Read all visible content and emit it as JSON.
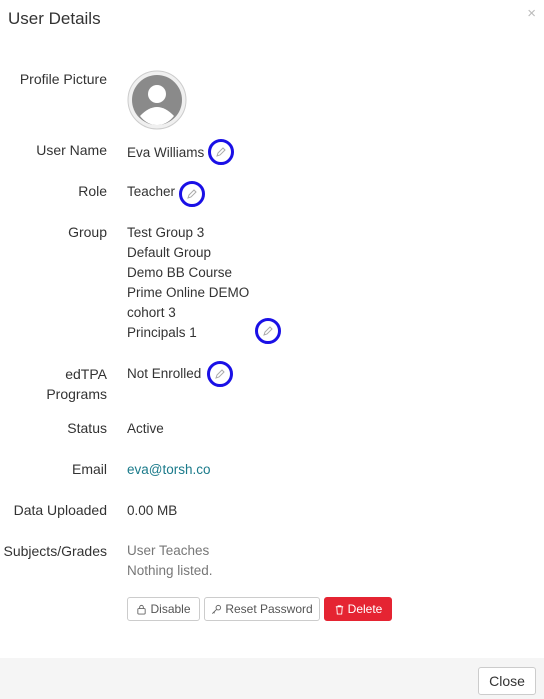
{
  "modal": {
    "title": "User Details",
    "close_icon": "×"
  },
  "fields": {
    "profile_picture_label": "Profile Picture",
    "user_name_label": "User Name",
    "user_name": "Eva Williams",
    "role_label": "Role",
    "role": "Teacher",
    "group_label": "Group",
    "groups": [
      "Test Group 3",
      "Default Group",
      "Demo BB Course",
      "Prime Online DEMO",
      "cohort 3",
      "Principals 1"
    ],
    "edtpa_label_line1": "edTPA",
    "edtpa_label_line2": "Programs",
    "edtpa_value": "Not Enrolled",
    "status_label": "Status",
    "status": "Active",
    "email_label": "Email",
    "email": "eva@torsh.co",
    "data_uploaded_label": "Data Uploaded",
    "data_uploaded": "0.00 MB",
    "subjects_label": "Subjects/Grades",
    "subjects_line1": "User Teaches",
    "subjects_line2": "Nothing listed."
  },
  "actions": {
    "disable": "Disable",
    "reset_password": "Reset Password",
    "delete": "Delete"
  },
  "footer": {
    "close": "Close"
  },
  "colors": {
    "accent_ring": "#1a10e6",
    "danger": "#e52432",
    "link": "#1a7a8a"
  }
}
